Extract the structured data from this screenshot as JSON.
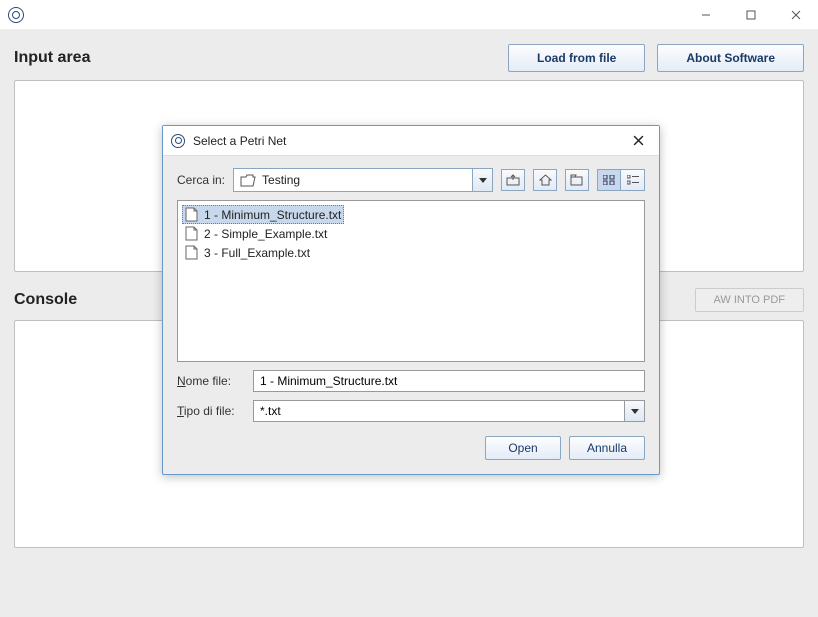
{
  "main": {
    "input_area_title": "Input area",
    "load_btn": "Load from file",
    "about_btn": "About Software",
    "console_title": "Console",
    "pdf_btn": "AW INTO PDF"
  },
  "dialog": {
    "title": "Select a Petri Net",
    "look_in_label": "Cerca in:",
    "look_in_value": "Testing",
    "files": [
      {
        "name": "1 - Minimum_Structure.txt",
        "selected": true
      },
      {
        "name": "2 - Simple_Example.txt",
        "selected": false
      },
      {
        "name": "3 - Full_Example.txt",
        "selected": false
      }
    ],
    "filename_label": "Nome file:",
    "filename_value": "1 - Minimum_Structure.txt",
    "filetype_label": "Tipo di file:",
    "filetype_value": "*.txt",
    "open_btn": "Open",
    "cancel_btn": "Annulla"
  }
}
